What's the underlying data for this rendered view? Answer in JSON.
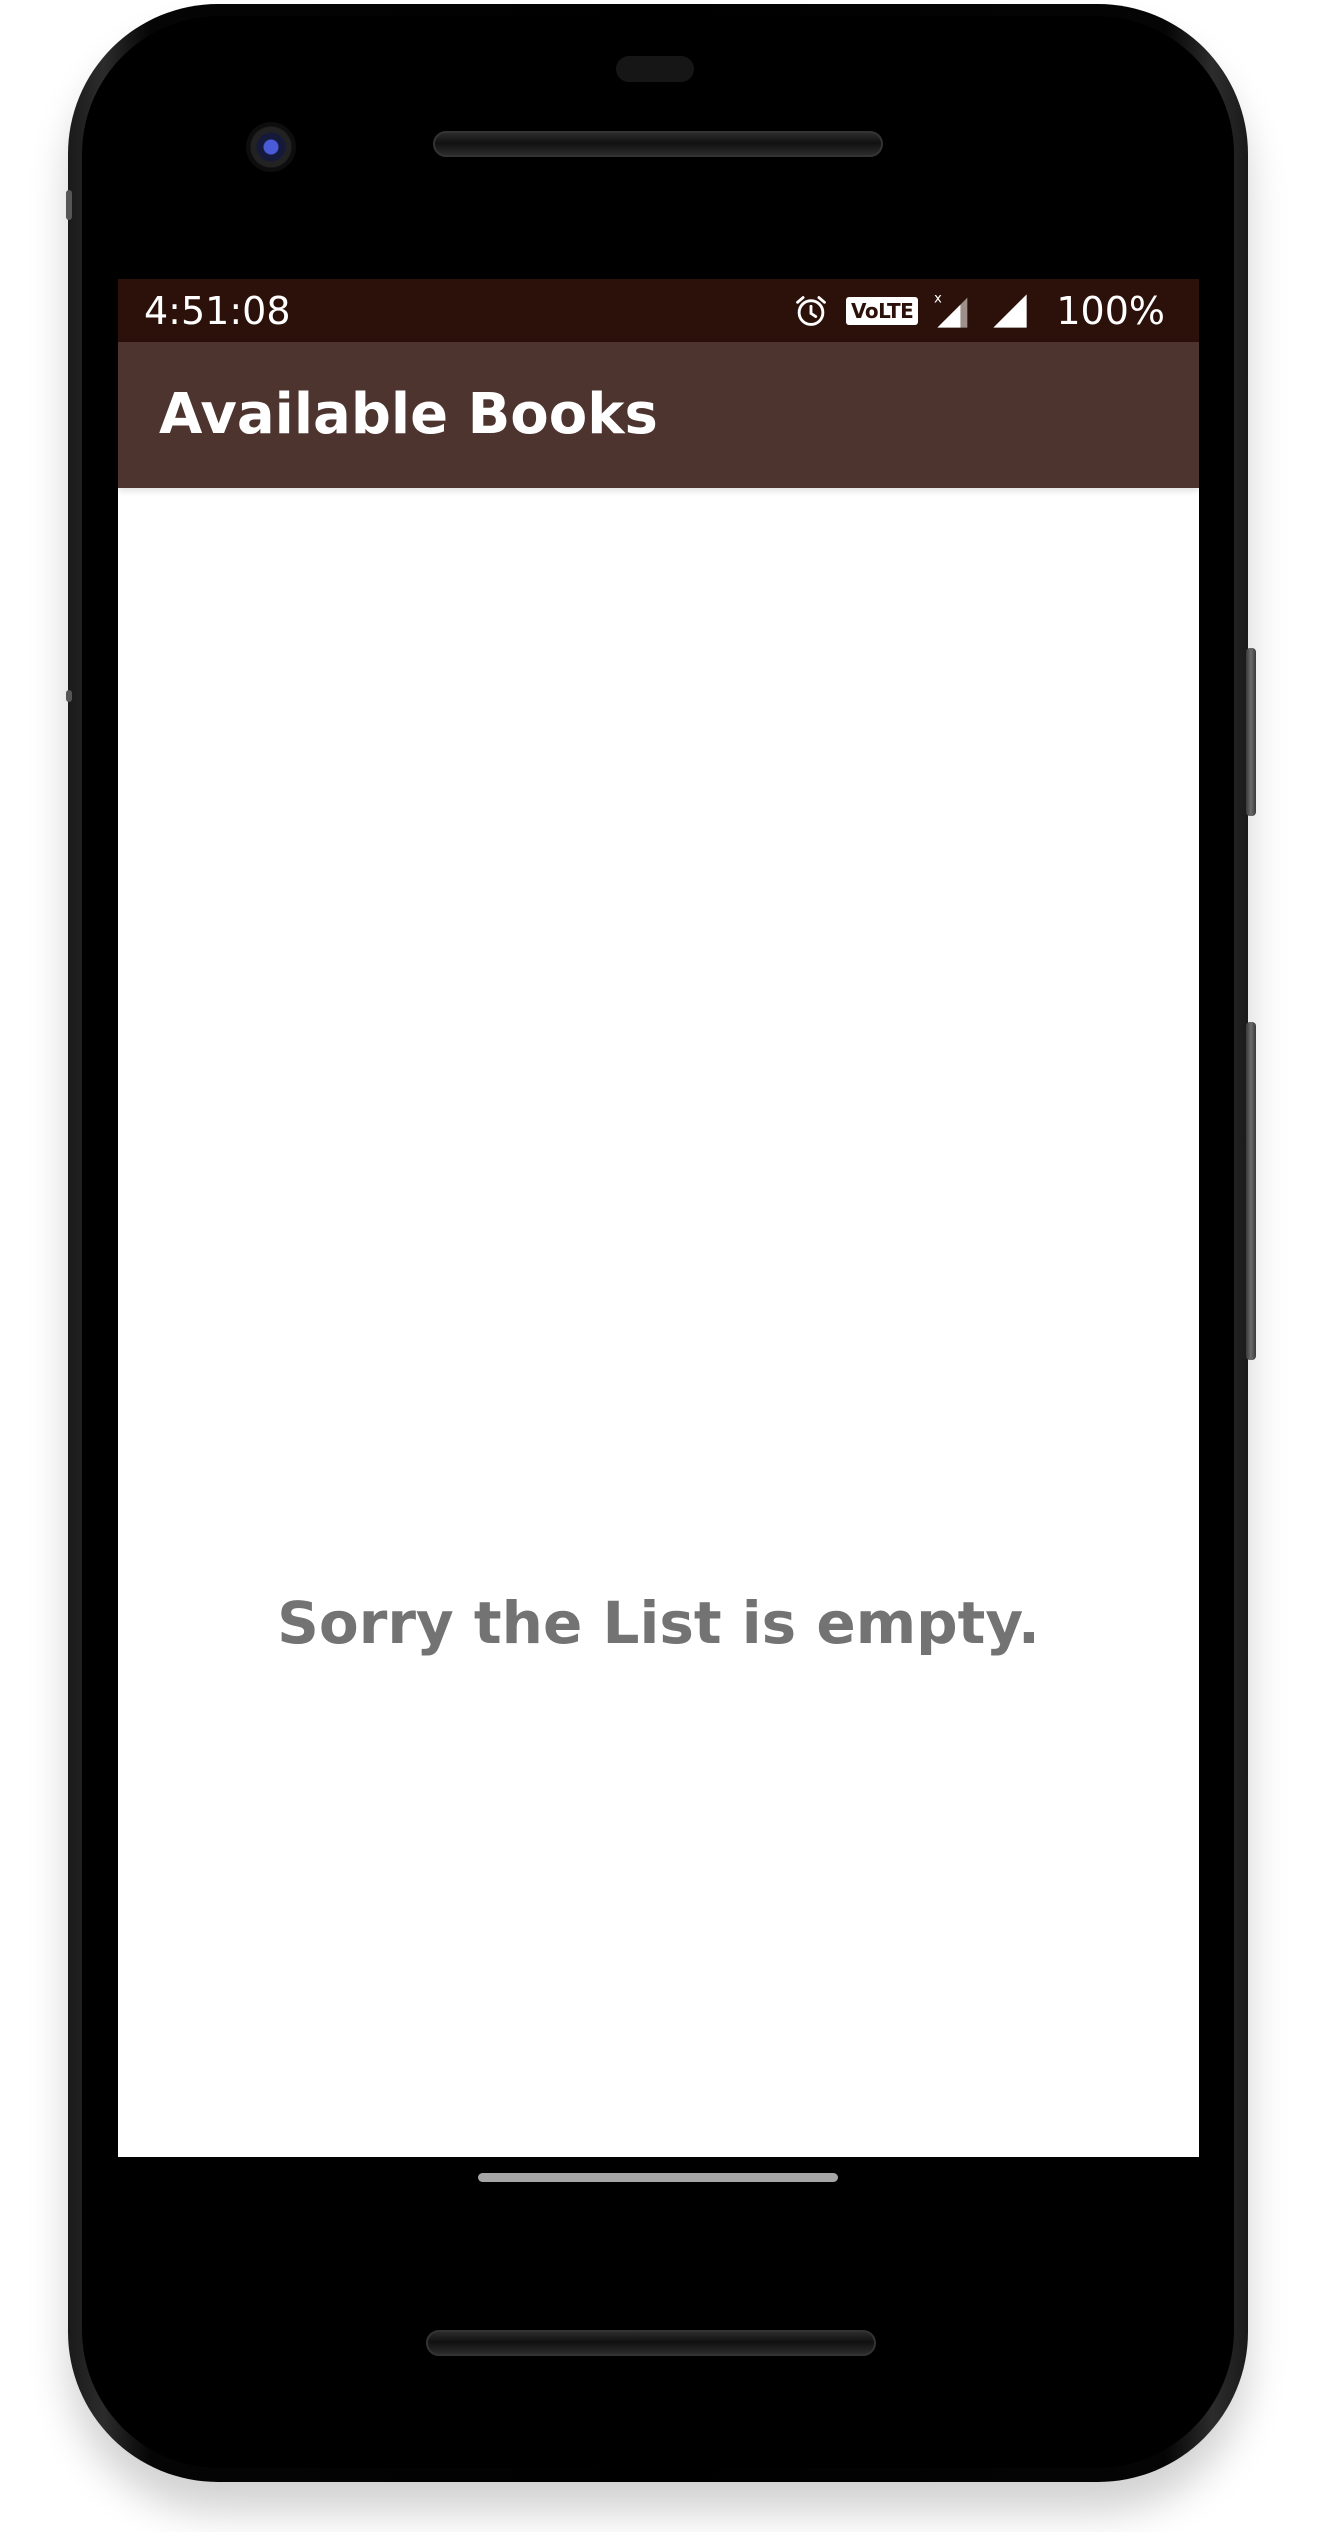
{
  "status_bar": {
    "time": "4:51:08",
    "volte_label": "VoLTE",
    "battery": "100%",
    "icons": [
      "alarm-icon",
      "volte-icon",
      "signal-icon",
      "signal-icon"
    ]
  },
  "app_bar": {
    "title": "Available Books",
    "color": "#4e342e"
  },
  "status_bar_color": "#2b1109",
  "main": {
    "empty_message": "Sorry the List is empty."
  }
}
